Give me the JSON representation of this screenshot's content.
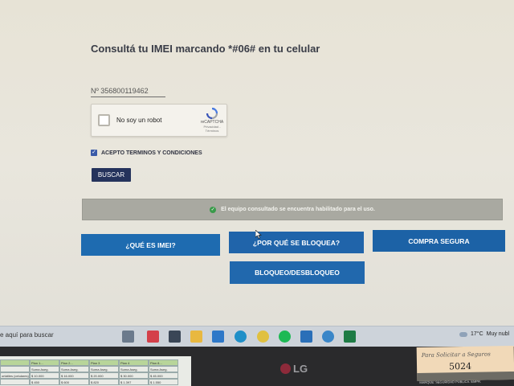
{
  "page": {
    "title": "Consultá tu IMEI marcando *#06# en tu celular",
    "imei_value": "Nº  356800119462",
    "recaptcha": {
      "label": "No soy un robot",
      "brand": "reCAPTCHA",
      "links": "Privacidad - Términos"
    },
    "terms_label": "ACEPTO TERMINOS Y CONDICIONES",
    "terms_checked": true,
    "search_button": "BUSCAR",
    "status_message": "El equipo consultado se encuentra habilitado para el uso.",
    "nav": {
      "what_is_imei": "¿QUÉ ES IMEI?",
      "why_blocked": "¿POR QUÉ SE BLOQUEA?",
      "safe_purchase": "COMPRA SEGURA",
      "block_unblock": "BLOQUEO/DESBLOQUEO"
    },
    "colors": {
      "nav_button": "#1e6bb0",
      "search_button": "#25335c",
      "status_bg": "#a9a9a1",
      "status_icon": "#3a9a4a"
    }
  },
  "taskbar": {
    "search_placeholder": "e aquí para buscar",
    "temperature": "17°C",
    "weather": "Muy nubl",
    "icons": [
      "task-view-icon",
      "media-icon",
      "calculator-icon",
      "file-explorer-icon",
      "mail-icon",
      "edge-icon",
      "chrome-icon",
      "spotify-icon",
      "app-icon",
      "teams-icon",
      "excel-icon"
    ]
  },
  "spreadsheet": {
    "headers": [
      "",
      "Plan 1...",
      "Plan 2...",
      "Plan 3",
      "Plan 4",
      "Plan 8..."
    ],
    "row1": [
      "",
      "Suma Aseg.",
      "Suma Aseg.",
      "Suma Aseg.",
      "Suma Aseg.",
      "Suma Aseg."
    ],
    "row2": [
      "ortátiles (celulares)",
      "$ 10.000",
      "$ 16.000",
      "$ 20.000",
      "$ 30.000",
      "$ 45.000"
    ],
    "row3": [
      "",
      "$ 450",
      "$ 600",
      "$ 820",
      "$ 1.397",
      "$ 1.550"
    ]
  },
  "monitor": {
    "brand": "LG"
  },
  "sticky_note": {
    "text": "Para Solicitar a Seguros",
    "number": "5024",
    "stripe": "MARQUE: SEGURIDAD PUBLICA. EMPR."
  }
}
